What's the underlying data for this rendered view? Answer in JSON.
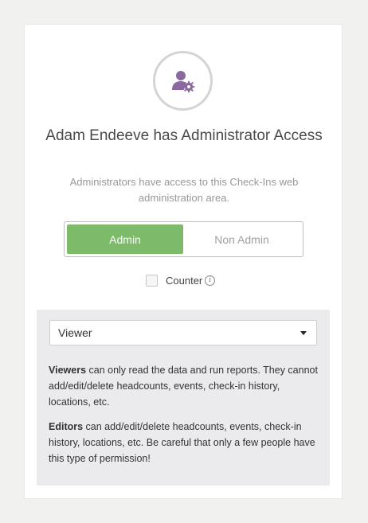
{
  "user": {
    "title": "Adam Endeeve has Administrator Access",
    "subtitle": "Administrators have access to this Check-Ins web administration area."
  },
  "access_toggle": {
    "options": [
      "Admin",
      "Non Admin"
    ],
    "selected": "Admin"
  },
  "counter": {
    "label": "Counter",
    "checked": false,
    "info_icon": "info-icon"
  },
  "permission": {
    "selected_value": "Viewer",
    "viewer_desc": {
      "term": "Viewers",
      "text": " can only read the data and run reports. They cannot add/edit/delete headcounts, events, check-in history, locations, etc."
    },
    "editor_desc": {
      "term": "Editors",
      "text": " can add/edit/delete headcounts, events, check-in history, locations, etc. Be careful that only a few people have this type of permission!"
    }
  },
  "colors": {
    "accent_green": "#7dbb6a",
    "avatar_purple": "#8a6a9e",
    "panel_bg": "#ebeaec"
  }
}
